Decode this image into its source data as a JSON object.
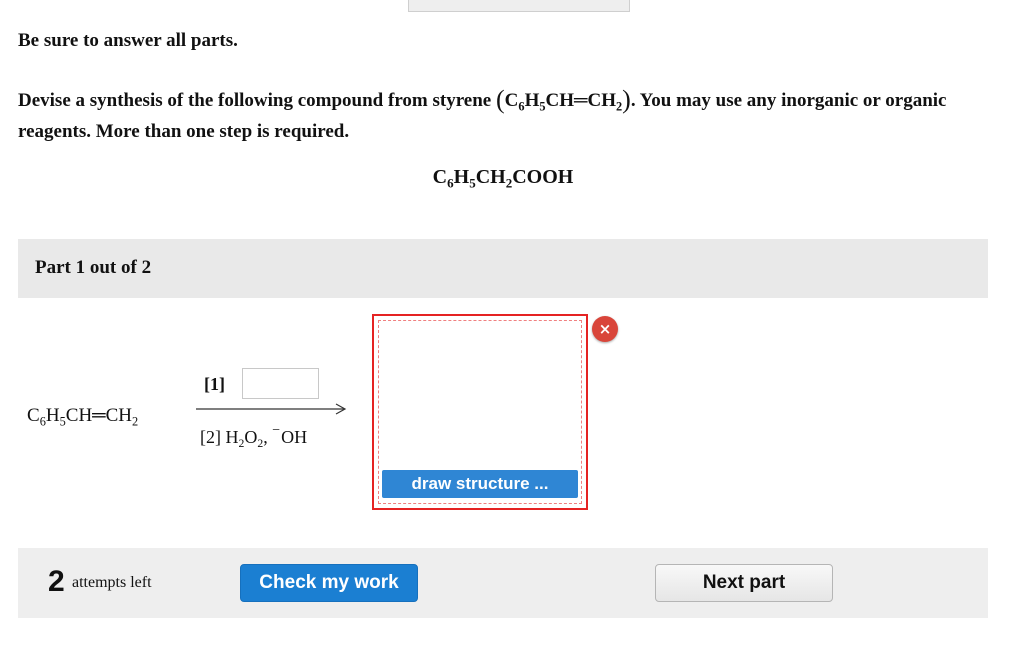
{
  "instruction": "Be sure to answer all parts.",
  "question": {
    "text_start": "Devise a synthesis of the following compound from styrene",
    "styrene_formula": {
      "c": "C",
      "c_sub": "6",
      "h": "H",
      "h_sub": "5",
      "rest": "CH═CH",
      "rest_sub": "2"
    },
    "text_end": ". You may use any inorganic or organic reagents. More than one step is required."
  },
  "target": {
    "p1": "C",
    "s1": "6",
    "p2": "H",
    "s2": "5",
    "p3": "CH",
    "s3": "2",
    "p4": "COOH"
  },
  "part": {
    "title": "Part 1 out of 2"
  },
  "reaction": {
    "reactant": {
      "p1": "C",
      "s1": "6",
      "p2": "H",
      "s2": "5",
      "p3": "CH═CH",
      "s3": "2"
    },
    "step1_label": "[1]",
    "step1_input_value": "",
    "step2": {
      "prefix": "[2] H",
      "s1": "2",
      "o": "O",
      "s2": "2",
      "comma": ",",
      "minus": "−",
      "oh": "OH"
    }
  },
  "answer_box": {
    "draw_button_label": "draw structure ...",
    "clear_icon_glyph": "×"
  },
  "footer": {
    "attempts_count": "2",
    "attempts_text": "attempts left",
    "check_label": "Check my work",
    "next_label": "Next part"
  },
  "colors": {
    "primary_button": "#1b7fd2",
    "draw_button": "#2f86d4",
    "error_border": "#e52323",
    "clear_icon": "#d9453a",
    "panel_bg": "#e9e9e9"
  }
}
